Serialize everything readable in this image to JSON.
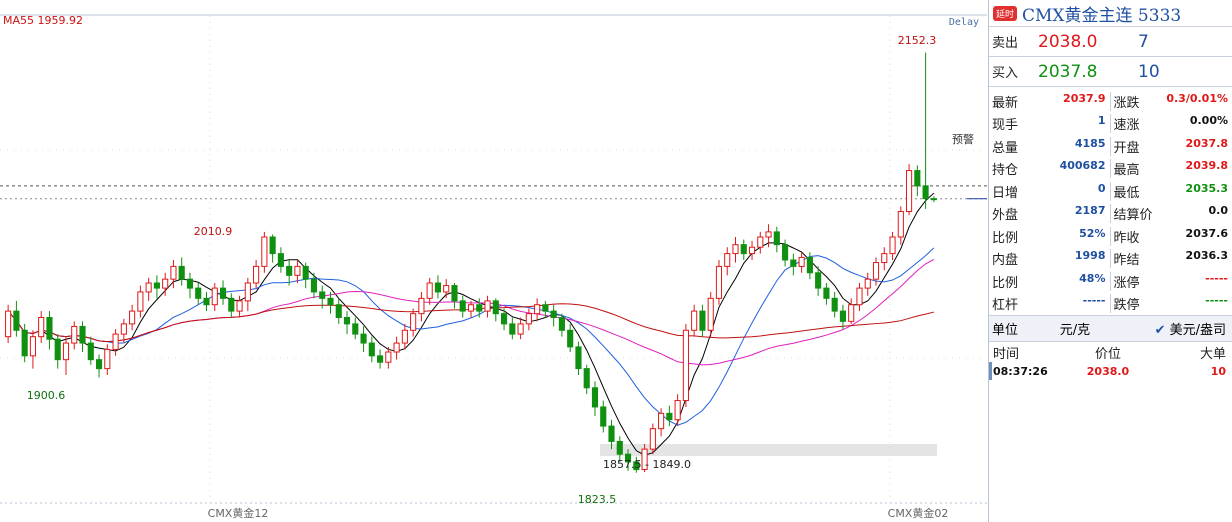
{
  "chart_data": {
    "type": "candlestick",
    "ma_label": "MA55  1959.92",
    "delay": "Delay",
    "alert_label": "预警",
    "contract_labels": [
      "CMX黄金12",
      "CMX黄金02"
    ],
    "annotations": [
      {
        "text": "2152.3",
        "value": 2152.3
      },
      {
        "text": "2010.9",
        "value": 2010.9
      },
      {
        "text": "1900.6",
        "value": 1900.6
      },
      {
        "text": "1823.5",
        "value": 1823.5
      },
      {
        "text": "1857.5 - 1849.0"
      }
    ],
    "ylim": [
      1810,
      2170
    ],
    "alert_price": 2048,
    "last_price": 2037.9,
    "candles": [
      [
        1930,
        1950,
        1925,
        1955
      ],
      [
        1950,
        1935,
        1930,
        1958
      ],
      [
        1935,
        1915,
        1910,
        1940
      ],
      [
        1915,
        1930,
        1905,
        1935
      ],
      [
        1930,
        1945,
        1925,
        1950
      ],
      [
        1945,
        1928,
        1920,
        1950
      ],
      [
        1928,
        1912,
        1905,
        1932
      ],
      [
        1912,
        1925,
        1900,
        1930
      ],
      [
        1925,
        1938,
        1920,
        1942
      ],
      [
        1938,
        1925,
        1918,
        1942
      ],
      [
        1925,
        1912,
        1908,
        1930
      ],
      [
        1912,
        1905,
        1898,
        1916
      ],
      [
        1905,
        1920,
        1900,
        1924
      ],
      [
        1920,
        1932,
        1915,
        1936
      ],
      [
        1932,
        1940,
        1925,
        1944
      ],
      [
        1940,
        1950,
        1935,
        1955
      ],
      [
        1950,
        1965,
        1945,
        1970
      ],
      [
        1965,
        1972,
        1958,
        1976
      ],
      [
        1972,
        1968,
        1960,
        1978
      ],
      [
        1968,
        1975,
        1962,
        1980
      ],
      [
        1975,
        1985,
        1968,
        1990
      ],
      [
        1985,
        1975,
        1970,
        1992
      ],
      [
        1975,
        1968,
        1960,
        1980
      ],
      [
        1968,
        1960,
        1955,
        1972
      ],
      [
        1960,
        1955,
        1950,
        1965
      ],
      [
        1955,
        1968,
        1950,
        1972
      ],
      [
        1968,
        1960,
        1955,
        1974
      ],
      [
        1960,
        1950,
        1945,
        1964
      ],
      [
        1950,
        1958,
        1945,
        1962
      ],
      [
        1958,
        1972,
        1950,
        1976
      ],
      [
        1972,
        1985,
        1968,
        1990
      ],
      [
        1985,
        2008,
        1980,
        2012
      ],
      [
        2008,
        1995,
        1988,
        2010
      ],
      [
        1995,
        1985,
        1980,
        2000
      ],
      [
        1985,
        1978,
        1970,
        1990
      ],
      [
        1978,
        1985,
        1972,
        1990
      ],
      [
        1985,
        1975,
        1968,
        1988
      ],
      [
        1975,
        1965,
        1960,
        1980
      ],
      [
        1965,
        1960,
        1952,
        1970
      ],
      [
        1960,
        1955,
        1948,
        1965
      ],
      [
        1955,
        1945,
        1940,
        1960
      ],
      [
        1945,
        1940,
        1932,
        1950
      ],
      [
        1940,
        1932,
        1928,
        1945
      ],
      [
        1932,
        1925,
        1918,
        1938
      ],
      [
        1925,
        1915,
        1910,
        1930
      ],
      [
        1915,
        1910,
        1905,
        1920
      ],
      [
        1910,
        1918,
        1905,
        1922
      ],
      [
        1918,
        1925,
        1912,
        1930
      ],
      [
        1925,
        1935,
        1920,
        1940
      ],
      [
        1935,
        1948,
        1930,
        1952
      ],
      [
        1948,
        1960,
        1942,
        1965
      ],
      [
        1960,
        1972,
        1955,
        1976
      ],
      [
        1972,
        1965,
        1960,
        1978
      ],
      [
        1965,
        1970,
        1960,
        1975
      ],
      [
        1970,
        1958,
        1952,
        1972
      ],
      [
        1958,
        1950,
        1945,
        1962
      ],
      [
        1950,
        1955,
        1945,
        1958
      ],
      [
        1955,
        1950,
        1945,
        1960
      ],
      [
        1950,
        1958,
        1945,
        1962
      ],
      [
        1958,
        1948,
        1942,
        1960
      ],
      [
        1948,
        1940,
        1935,
        1952
      ],
      [
        1940,
        1932,
        1928,
        1945
      ],
      [
        1932,
        1940,
        1928,
        1945
      ],
      [
        1940,
        1948,
        1935,
        1952
      ],
      [
        1948,
        1955,
        1942,
        1960
      ],
      [
        1955,
        1950,
        1945,
        1958
      ],
      [
        1950,
        1945,
        1938,
        1955
      ],
      [
        1945,
        1935,
        1930,
        1948
      ],
      [
        1935,
        1922,
        1918,
        1940
      ],
      [
        1922,
        1905,
        1900,
        1926
      ],
      [
        1905,
        1890,
        1885,
        1908
      ],
      [
        1890,
        1875,
        1868,
        1895
      ],
      [
        1875,
        1860,
        1855,
        1880
      ],
      [
        1860,
        1848,
        1842,
        1865
      ],
      [
        1848,
        1838,
        1832,
        1852
      ],
      [
        1838,
        1832,
        1825,
        1842
      ],
      [
        1832,
        1826,
        1823.5,
        1836
      ],
      [
        1826,
        1842,
        1824,
        1846
      ],
      [
        1842,
        1858,
        1838,
        1862
      ],
      [
        1858,
        1870,
        1852,
        1874
      ],
      [
        1870,
        1865,
        1860,
        1876
      ],
      [
        1865,
        1880,
        1860,
        1885
      ],
      [
        1880,
        1935,
        1875,
        1940
      ],
      [
        1935,
        1950,
        1930,
        1955
      ],
      [
        1950,
        1935,
        1930,
        1955
      ],
      [
        1935,
        1960,
        1930,
        1965
      ],
      [
        1960,
        1985,
        1955,
        1990
      ],
      [
        1985,
        1995,
        1978,
        2000
      ],
      [
        1995,
        2002,
        1988,
        2008
      ],
      [
        2002,
        1995,
        1990,
        2006
      ],
      [
        1995,
        2000,
        1990,
        2005
      ],
      [
        2000,
        2008,
        1995,
        2012
      ],
      [
        2008,
        2012,
        2000,
        2018
      ],
      [
        2012,
        2002,
        1996,
        2016
      ],
      [
        2002,
        1990,
        1985,
        2006
      ],
      [
        1990,
        1985,
        1978,
        1995
      ],
      [
        1985,
        1992,
        1980,
        1996
      ],
      [
        1992,
        1980,
        1975,
        1996
      ],
      [
        1980,
        1968,
        1962,
        1985
      ],
      [
        1968,
        1960,
        1955,
        1972
      ],
      [
        1960,
        1950,
        1945,
        1965
      ],
      [
        1950,
        1942,
        1936,
        1955
      ],
      [
        1942,
        1955,
        1940,
        1960
      ],
      [
        1955,
        1968,
        1950,
        1972
      ],
      [
        1968,
        1975,
        1962,
        1980
      ],
      [
        1975,
        1988,
        1970,
        1992
      ],
      [
        1988,
        1995,
        1982,
        2000
      ],
      [
        1995,
        2008,
        1990,
        2012
      ],
      [
        2008,
        2028,
        2002,
        2032
      ],
      [
        2028,
        2060,
        2025,
        2065
      ],
      [
        2060,
        2048,
        2040,
        2064
      ],
      [
        2048,
        2038,
        2030,
        2152.3
      ],
      [
        2038,
        2037.9,
        2035.3,
        2039.8
      ]
    ]
  },
  "panel": {
    "badge": "延时",
    "title": "CMX黄金主连  5333",
    "sell_label": "卖出",
    "sell_price": "2038.0",
    "sell_vol": "7",
    "buy_label": "买入",
    "buy_price": "2037.8",
    "buy_vol": "10",
    "stats": [
      {
        "l1": "最新",
        "v1": "2037.9",
        "c1": "red",
        "l2": "涨跌",
        "v2": "0.3/0.01%",
        "c2": "red"
      },
      {
        "l1": "现手",
        "v1": "1",
        "c1": "blue",
        "l2": "速涨",
        "v2": "0.00%",
        "c2": "black"
      },
      {
        "l1": "总量",
        "v1": "4185",
        "c1": "blue",
        "l2": "开盘",
        "v2": "2037.8",
        "c2": "red"
      },
      {
        "l1": "持仓",
        "v1": "400682",
        "c1": "blue",
        "l2": "最高",
        "v2": "2039.8",
        "c2": "red"
      },
      {
        "l1": "日增",
        "v1": "0",
        "c1": "blue",
        "l2": "最低",
        "v2": "2035.3",
        "c2": "green"
      },
      {
        "l1": "外盘",
        "v1": "2187",
        "c1": "blue",
        "l2": "结算价",
        "v2": "0.0",
        "c2": "black"
      },
      {
        "l1": "比例",
        "v1": "52%",
        "c1": "blue",
        "l2": "昨收",
        "v2": "2037.6",
        "c2": "black"
      },
      {
        "l1": "内盘",
        "v1": "1998",
        "c1": "blue",
        "l2": "昨结",
        "v2": "2036.3",
        "c2": "black"
      },
      {
        "l1": "比例",
        "v1": "48%",
        "c1": "blue",
        "l2": "涨停",
        "v2": "-----",
        "c2": "red"
      },
      {
        "l1": "杠杆",
        "v1": "-----",
        "c1": "blue",
        "l2": "跌停",
        "v2": "-----",
        "c2": "green"
      }
    ],
    "unit_label": "单位",
    "unit_value": "元/克",
    "unit_alt": "美元/盎司",
    "tick_headers": [
      "时间",
      "价位",
      "大单"
    ],
    "ticks": [
      {
        "time": "08:37:26",
        "price": "2038.0",
        "vol": "10"
      }
    ]
  },
  "colors": {
    "up": "#e01818",
    "down": "#109010",
    "ma1": "#000000",
    "ma2": "#2060e0",
    "ma3": "#e020c0",
    "ma4": "#c01010"
  }
}
